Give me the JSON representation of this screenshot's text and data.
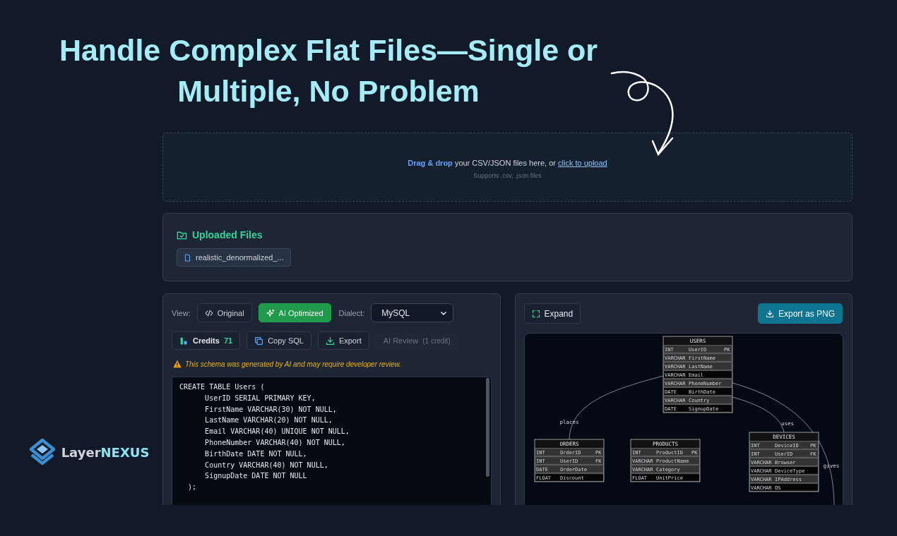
{
  "headline": "Handle Complex Flat Files—Single or\nMultiple, No Problem",
  "dropzone": {
    "text": "**Drag & drop** your CSV/JSON files here, or ",
    "link": "click to upload",
    "hint": "Supports .csv, .json files"
  },
  "uploaded": {
    "title": "Uploaded Files",
    "files": [
      {
        "name": "realistic_denormalized_..."
      }
    ]
  },
  "editor": {
    "view_label": "View:",
    "view_options": [
      {
        "label": "Original",
        "kind": "code",
        "selected": false
      },
      {
        "label": "AI Optimized",
        "kind": "sparkle",
        "selected": true
      }
    ],
    "dialect_label": "Dialect:",
    "dialect": "MySQL",
    "actions": [
      {
        "kind": "credits",
        "label": "Credits",
        "count": "71",
        "disabled": false
      },
      {
        "kind": "copy",
        "label": "Copy SQL",
        "disabled": false
      },
      {
        "kind": "export",
        "label": "Export",
        "disabled": false
      },
      {
        "kind": "review",
        "label": "AI Review",
        "note": "(1 credit)",
        "disabled": true
      }
    ],
    "warning": "This schema was generated by AI and may require developer review.",
    "code": [
      "CREATE TABLE Users (",
      "      UserID SERIAL PRIMARY KEY,",
      "      FirstName VARCHAR(30) NOT NULL,",
      "      LastName VARCHAR(20) NOT NULL,",
      "      Email VARCHAR(40) UNIQUE NOT NULL,",
      "      PhoneNumber VARCHAR(40) NOT NULL,",
      "      BirthDate DATE NOT NULL,",
      "      Country VARCHAR(40) NOT NULL,",
      "      SignupDate DATE NOT NULL",
      "  );"
    ]
  },
  "diagram": {
    "expand": "Expand",
    "export": "Export as PNG",
    "entities": [
      {
        "name": "USERS",
        "columns": [
          [
            "INT",
            "UserID",
            "PK"
          ],
          [
            "VARCHAR",
            "FirstName",
            ""
          ],
          [
            "VARCHAR",
            "LastName",
            ""
          ],
          [
            "VARCHAR",
            "Email",
            ""
          ],
          [
            "VARCHAR",
            "PhoneNumber",
            ""
          ],
          [
            "DATE",
            "BirthDate",
            ""
          ],
          [
            "VARCHAR",
            "Country",
            ""
          ],
          [
            "DATE",
            "SignupDate",
            ""
          ]
        ]
      },
      {
        "name": "ORDERS",
        "columns": [
          [
            "INT",
            "OrderID",
            "PK"
          ],
          [
            "INT",
            "UserID",
            "FK"
          ],
          [
            "DATE",
            "OrderDate",
            ""
          ],
          [
            "FLOAT",
            "Discount",
            ""
          ]
        ]
      },
      {
        "name": "PRODUCTS",
        "columns": [
          [
            "INT",
            "ProductID",
            "PK"
          ],
          [
            "VARCHAR",
            "ProductName",
            ""
          ],
          [
            "VARCHAR",
            "Category",
            ""
          ],
          [
            "FLOAT",
            "UnitPrice",
            ""
          ]
        ]
      },
      {
        "name": "DEVICES",
        "columns": [
          [
            "INT",
            "DeviceID",
            "PK"
          ],
          [
            "INT",
            "UserID",
            "FK"
          ],
          [
            "VARCHAR",
            "Browser",
            ""
          ],
          [
            "VARCHAR",
            "DeviceType",
            ""
          ],
          [
            "VARCHAR",
            "IPAddress",
            ""
          ],
          [
            "VARCHAR",
            "OS",
            ""
          ]
        ]
      }
    ],
    "relations": [
      {
        "label": "places"
      },
      {
        "label": "uses"
      },
      {
        "label": "gives"
      }
    ]
  },
  "logo": {
    "parts": [
      "Layer",
      "NEXUS"
    ]
  }
}
